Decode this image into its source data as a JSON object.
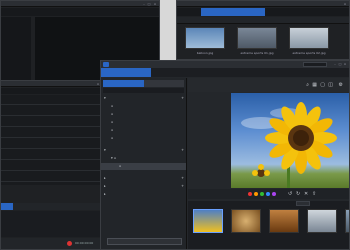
{
  "top_left_window": {
    "title": "",
    "tabs": [
      "",
      "",
      "",
      "",
      ""
    ],
    "tracks": [
      "",
      "",
      "",
      ""
    ]
  },
  "top_right_window": {
    "title": "",
    "tabs": [
      "",
      "",
      "",
      "",
      ""
    ],
    "thumbnails": [
      {
        "name": "balloon.jpg"
      },
      {
        "name": "extreme sports 01.jpg"
      },
      {
        "name": "extreme sports 02.jpg"
      }
    ]
  },
  "left_window": {
    "title": "",
    "tabs": [
      "",
      "",
      "",
      "",
      ""
    ],
    "counter": "00:00:00:00"
  },
  "main_window": {
    "title": "",
    "menu": [
      "",
      "",
      "",
      "",
      "",
      "",
      "",
      ""
    ],
    "mode_tabs": [
      "",
      "",
      "",
      "",
      "",
      ""
    ],
    "search_tabs": [
      "",
      ""
    ],
    "tree": [
      {
        "label": "",
        "level": 0
      },
      {
        "label": "",
        "level": 1
      },
      {
        "label": "",
        "level": 1
      },
      {
        "label": "",
        "level": 1
      },
      {
        "label": "",
        "level": 1
      },
      {
        "label": "",
        "level": 1
      },
      {
        "label": "",
        "level": 0
      },
      {
        "label": "",
        "level": 1
      },
      {
        "label": "",
        "level": 2
      },
      {
        "label": "",
        "level": 0
      },
      {
        "label": "",
        "level": 0
      },
      {
        "label": "",
        "level": 0
      }
    ],
    "import_button": "",
    "bottom_button": "",
    "filmstrip_count": 5,
    "accent": "#2a66c4"
  }
}
